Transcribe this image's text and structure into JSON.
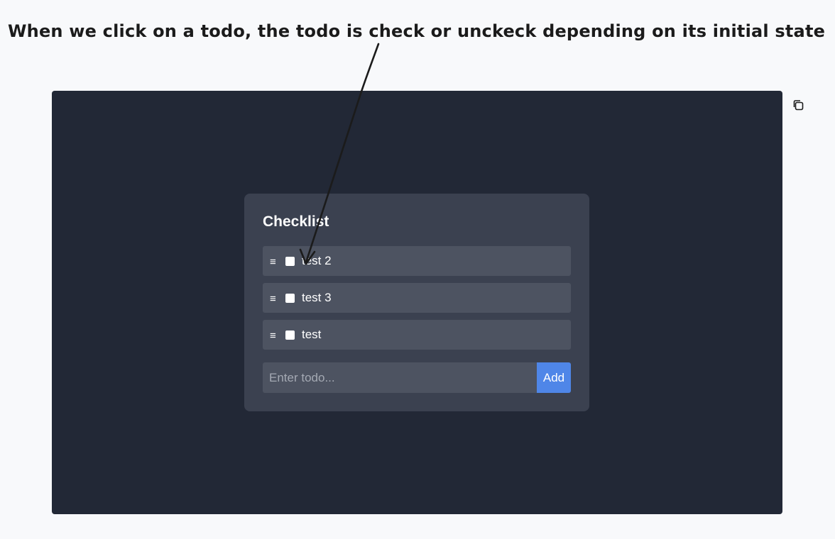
{
  "annotation": {
    "text": "When we click on a todo, the todo is check or unckeck depending on its initial state"
  },
  "toolbar": {
    "copy_icon": "copy-icon"
  },
  "checklist": {
    "title": "Checklist",
    "items": [
      {
        "label": "test 2",
        "checked": false
      },
      {
        "label": "test 3",
        "checked": false
      },
      {
        "label": "test",
        "checked": false
      }
    ],
    "input": {
      "value": "",
      "placeholder": "Enter todo..."
    },
    "add_label": "Add"
  },
  "colors": {
    "page_bg": "#f8f9fb",
    "preview_bg": "#222836",
    "card_bg": "#3b4150",
    "item_bg": "#4d5361",
    "accent": "#4f86e8",
    "annotation_ink": "#1b1b1b"
  }
}
